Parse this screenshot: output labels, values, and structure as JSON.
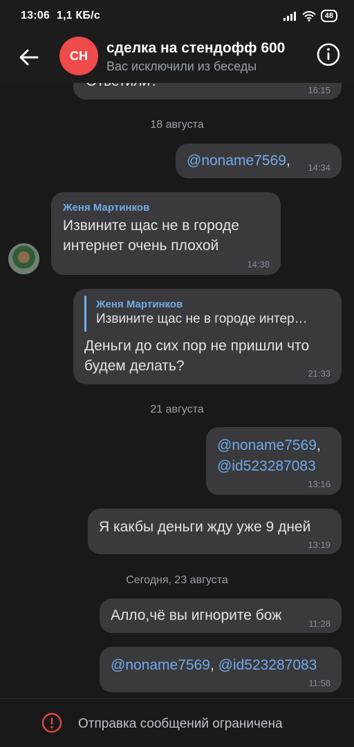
{
  "status_bar": {
    "time": "13:06",
    "network_speed": "1,1 КБ/с",
    "battery": "48"
  },
  "header": {
    "avatar_initials": "СН",
    "title": "сделка на стендофф 600",
    "subtitle": "Вас исключили из беседы"
  },
  "messages": [
    {
      "text": "Ответили?",
      "time": "16:15"
    },
    {
      "date": "18 августа"
    },
    {
      "text": "@noname7569",
      "suffix": ",",
      "time": "14:34"
    },
    {
      "sender": "Женя Мартинков",
      "line1": "Извините щас не в городе",
      "line2": "интернет очень плохой",
      "time": "14:38"
    },
    {
      "reply_sender": "Женя Мартинков",
      "reply_text": "Извините щас не в городе интер…",
      "line1": "Деньги до сих пор не пришли что",
      "line2": "будем делать?",
      "time": "21:33"
    },
    {
      "date": "21 августа"
    },
    {
      "line1": "@noname7569",
      "line1_suffix": ",",
      "line2": "@id523287083",
      "time": "13:16"
    },
    {
      "text": "Я какбы деньги жду уже 9 дней",
      "time": "13:19"
    },
    {
      "date": "Сегодня, 23 августа"
    },
    {
      "text": "Алло,чё вы игнорите бож",
      "time": "11:28"
    },
    {
      "mention1": "@noname7569",
      "sep": ", ",
      "mention2": "@id523287083",
      "time": "11:58"
    }
  ],
  "footer": {
    "text": "Отправка сообщений ограничена"
  },
  "colors": {
    "background": "#19191a",
    "bubble": "#3a3a3c",
    "accent": "#71aaeb",
    "avatar": "#ef4a4a",
    "footer_icon": "#e64646"
  },
  "icons": {
    "back": "arrow-left-icon",
    "info": "info-icon",
    "restricted": "alert-circle-icon"
  }
}
